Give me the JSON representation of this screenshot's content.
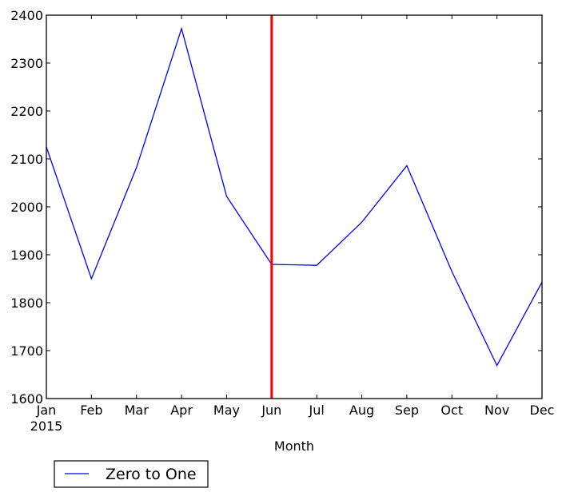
{
  "chart_data": {
    "type": "line",
    "title": "",
    "xlabel": "Month",
    "ylabel": "",
    "categories": [
      "Jan",
      "Feb",
      "Mar",
      "Apr",
      "May",
      "Jun",
      "Jul",
      "Aug",
      "Sep",
      "Oct",
      "Nov",
      "Dec"
    ],
    "year_label": "2015",
    "yticks": [
      "1600",
      "1700",
      "1800",
      "1900",
      "2000",
      "2100",
      "2200",
      "2300",
      "2400"
    ],
    "ylim": [
      1600,
      2400
    ],
    "grid": false,
    "series": [
      {
        "name": "Zero to One",
        "color": "#0000ff",
        "values": [
          2125,
          1850,
          2082,
          2372,
          2022,
          1880,
          1878,
          1968,
          2086,
          1865,
          1669,
          1843
        ]
      }
    ],
    "annotations": [
      {
        "type": "vertical-line",
        "at": "Jun",
        "color": "#ff0000"
      }
    ],
    "legend": {
      "placement": "bottom-left-outside",
      "entries": [
        "Zero to One"
      ]
    }
  }
}
